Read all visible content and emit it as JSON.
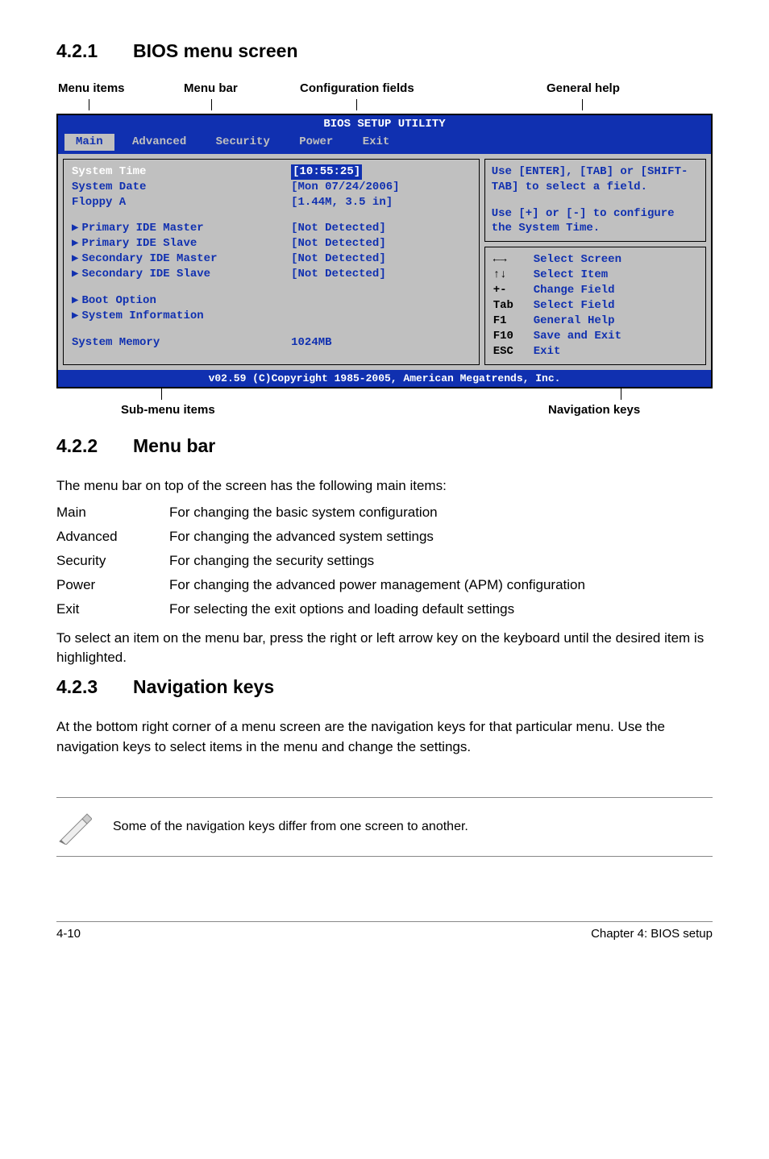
{
  "sections": {
    "s1": {
      "num": "4.2.1",
      "title": "BIOS menu screen"
    },
    "s2": {
      "num": "4.2.2",
      "title": "Menu bar"
    },
    "s3": {
      "num": "4.2.3",
      "title": "Navigation keys"
    }
  },
  "toplabels": {
    "items": "Menu items",
    "bar": "Menu bar",
    "cfg": "Configuration fields",
    "help": "General help"
  },
  "sublabels": {
    "sub": "Sub-menu items",
    "nav": "Navigation keys"
  },
  "bios": {
    "header": "BIOS SETUP UTILITY",
    "menubar": [
      "Main",
      "Advanced",
      "Security",
      "Power",
      "Exit"
    ],
    "left": {
      "g1": [
        {
          "k": "System Time",
          "v": "[10:55:25]",
          "sel": true
        },
        {
          "k": "System Date",
          "v": "[Mon 07/24/2006]"
        },
        {
          "k": "Floppy A",
          "v": "[1.44M, 3.5 in]"
        }
      ],
      "g2": [
        {
          "k": "Primary IDE Master",
          "v": "[Not Detected]",
          "arrow": true
        },
        {
          "k": "Primary IDE Slave",
          "v": "[Not Detected]",
          "arrow": true
        },
        {
          "k": "Secondary IDE Master",
          "v": "[Not Detected]",
          "arrow": true
        },
        {
          "k": "Secondary IDE Slave",
          "v": "[Not Detected]",
          "arrow": true
        }
      ],
      "g3": [
        {
          "k": "Boot Option",
          "arrow": true
        },
        {
          "k": "System Information",
          "arrow": true
        }
      ],
      "g4": [
        {
          "k": "System Memory",
          "v": "1024MB"
        }
      ]
    },
    "help": {
      "p1": "Use [ENTER], [TAB] or [SHIFT-TAB] to select a field.",
      "p2": "Use [+] or [-] to configure the System Time."
    },
    "nav": [
      {
        "k": "←→",
        "d": "Select Screen"
      },
      {
        "k": "↑↓",
        "d": "Select Item"
      },
      {
        "k": "+-",
        "d": "Change Field"
      },
      {
        "k": "Tab",
        "d": "Select Field"
      },
      {
        "k": "F1",
        "d": "General Help"
      },
      {
        "k": "F10",
        "d": "Save and Exit"
      },
      {
        "k": "ESC",
        "d": "Exit"
      }
    ],
    "footer": "v02.59 (C)Copyright 1985-2005, American Megatrends, Inc."
  },
  "s2text": {
    "intro": "The menu bar on top of the screen has the following main items:",
    "defs": [
      {
        "t": "Main",
        "d": "For changing the basic system configuration"
      },
      {
        "t": "Advanced",
        "d": "For changing the advanced system settings"
      },
      {
        "t": "Security",
        "d": "For changing the security settings"
      },
      {
        "t": "Power",
        "d": "For changing the advanced power management (APM) configuration"
      },
      {
        "t": "Exit",
        "d": "For selecting the exit options and loading default settings"
      }
    ],
    "outro": "To select an item on the menu bar, press the right or left arrow key on the keyboard until the desired item is highlighted."
  },
  "s3text": "At the bottom right corner of a menu screen are the navigation keys for that particular menu. Use the navigation keys to select items in the menu and change the settings.",
  "note": "Some of the navigation keys differ from one screen to another.",
  "footer": {
    "left": "4-10",
    "right": "Chapter 4: BIOS setup"
  }
}
